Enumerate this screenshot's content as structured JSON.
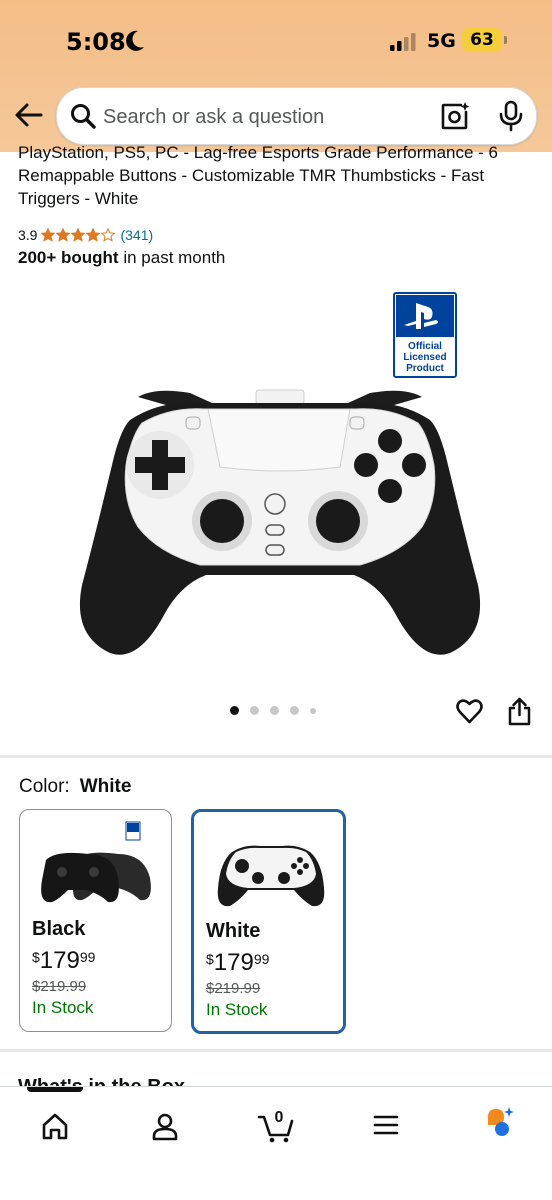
{
  "status_bar": {
    "time": "5:08",
    "network": "5G",
    "battery": "63"
  },
  "search": {
    "placeholder": "Search or ask a question"
  },
  "product": {
    "title": "PlayStation, PS5, PC - Lag-free Esports Grade Performance - 6 Remappable Buttons - Customizable TMR Thumbsticks - Fast Triggers - White",
    "rating": "3.9",
    "stars": 3.9,
    "review_count": "(341)",
    "bought_strong": "200+ bought",
    "bought_rest": " in past month",
    "badge": {
      "line1": "Official",
      "line2": "Licensed",
      "line3": "Product"
    },
    "carousel": {
      "total": 5,
      "active": 1
    }
  },
  "color": {
    "label": "Color:",
    "selected": "White",
    "options": [
      {
        "name": "Black",
        "currency": "$",
        "whole": "179",
        "fraction": "99",
        "list_price": "$219.99",
        "stock": "In Stock"
      },
      {
        "name": "White",
        "currency": "$",
        "whole": "179",
        "fraction": "99",
        "list_price": "$219.99",
        "stock": "In Stock"
      }
    ]
  },
  "next_section": {
    "heading": "What's in the Box"
  },
  "tab_bar": {
    "items": [
      "home-icon",
      "account-icon",
      "cart-icon",
      "menu-icon",
      "rufus-icon"
    ],
    "cart_count": "0"
  },
  "colors": {
    "header_top": "#f3bd86",
    "link": "#007185",
    "stock": "#007600",
    "selected_border": "#2162a1",
    "star": "#de7921"
  }
}
